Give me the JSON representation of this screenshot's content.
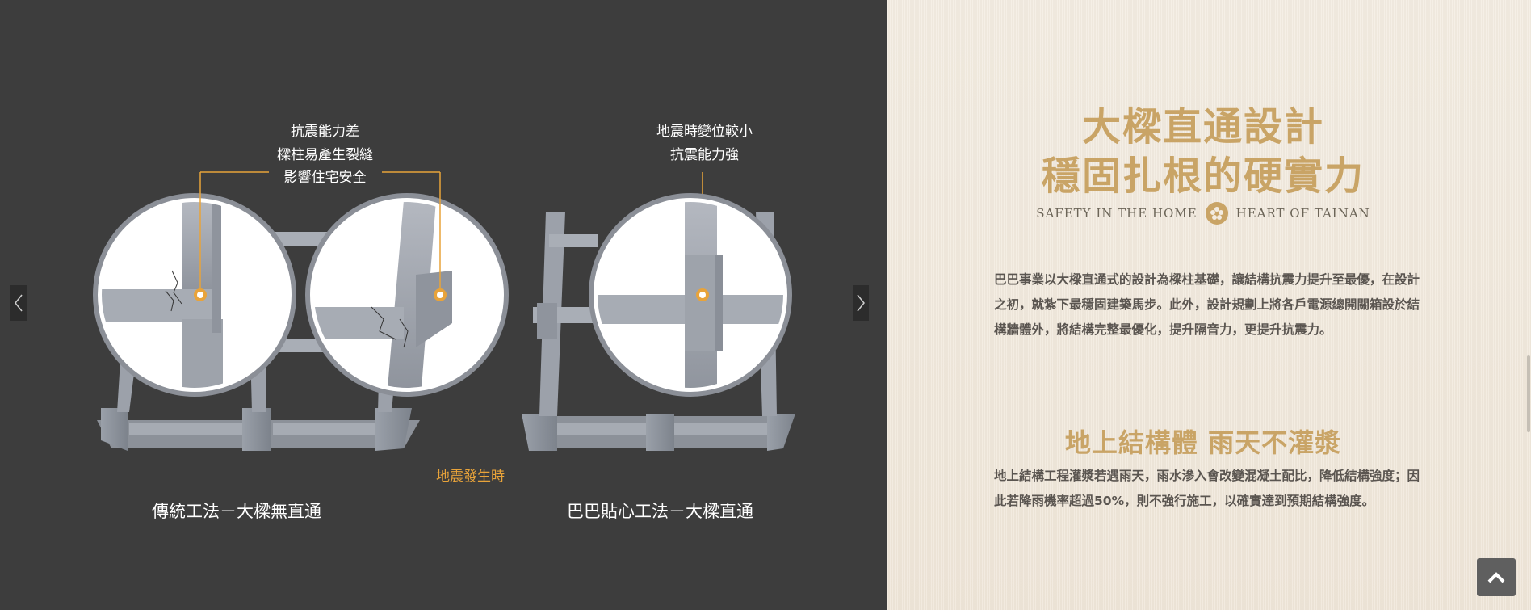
{
  "nav": {
    "prev_icon": "chevron-left-icon",
    "next_icon": "chevron-right-icon"
  },
  "callouts": {
    "left": [
      "抗震能力差",
      "樑柱易產生裂縫",
      "影響住宅安全"
    ],
    "right": [
      "地震時變位較小",
      "抗震能力強"
    ]
  },
  "earthquake_label": "地震發生時",
  "captions": {
    "traditional": "傳統工法－大樑無直通",
    "baba": "巴巴貼心工法－大樑直通"
  },
  "heading": {
    "line1": "大樑直通設計",
    "line2": "穩固扎根的硬實力"
  },
  "tagline": {
    "left": "SAFETY IN THE HOME",
    "right": "HEART OF TAINAN"
  },
  "paragraph1": "巴巴事業以大樑直通式的設計為樑柱基礎，讓結構抗震力提升至最優，在設計之初，就紮下最穩固建築馬步。此外，設計規劃上將各戶電源總開關箱設於結構牆體外，將結構完整最優化，提升隔音力，更提升抗震力。",
  "subheading": "地上結構體 雨天不灌漿",
  "paragraph2": "地上結構工程灌漿若遇雨天，雨水滲入會改變混凝土配比，降低結構強度；因此若降雨機率超過50%，則不強行施工，以確實達到預期結構強度。",
  "colors": {
    "dark_bg": "#3d3d3d",
    "cream_bg": "#f3ece1",
    "gold": "#c9a466",
    "orange": "#e8a33a"
  }
}
